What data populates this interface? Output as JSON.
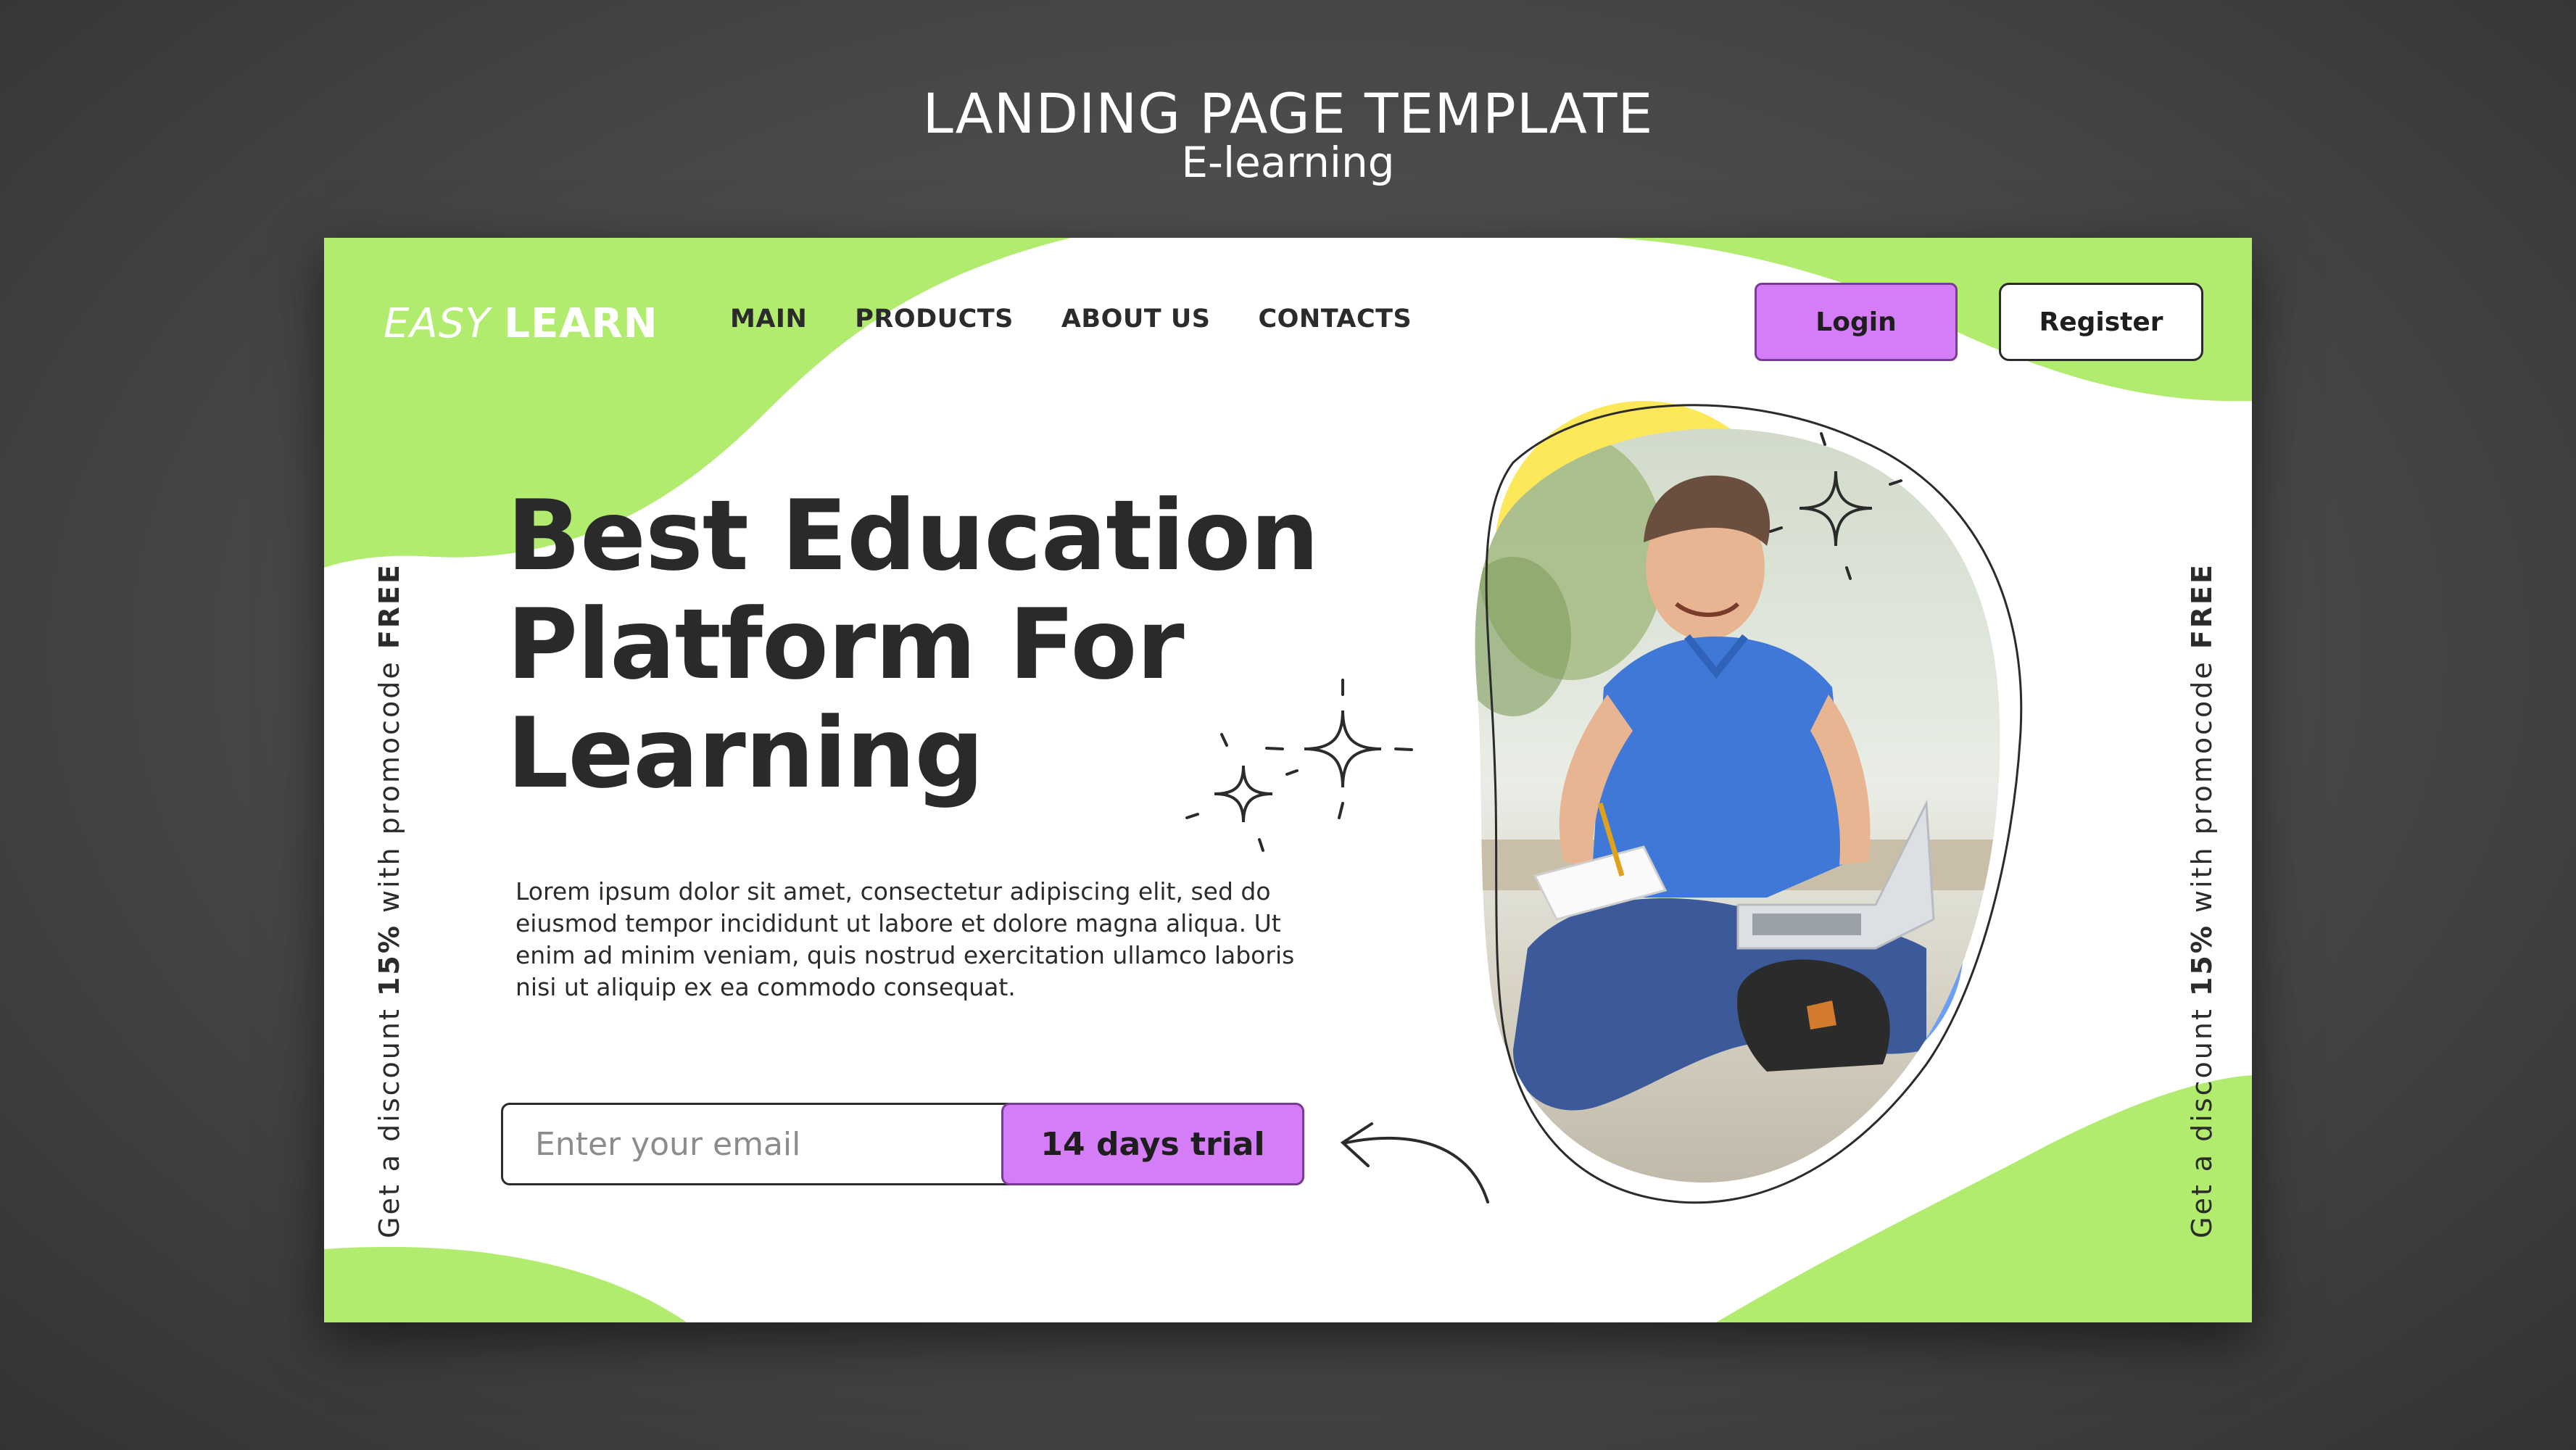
{
  "showcase": {
    "title": "LANDING PAGE TEMPLATE",
    "subtitle": "E-learning"
  },
  "brand": {
    "logo_part1": "EASY",
    "logo_part2": "LEARN"
  },
  "nav": {
    "items": [
      {
        "label": "MAIN"
      },
      {
        "label": "PRODUCTS"
      },
      {
        "label": "ABOUT US"
      },
      {
        "label": "CONTACTS"
      }
    ]
  },
  "auth": {
    "login_label": "Login",
    "register_label": "Register"
  },
  "hero": {
    "title_lines": [
      "Best Education",
      "Platform For",
      "Learning"
    ],
    "body": "Lorem ipsum dolor sit amet, consectetur adipiscing elit, sed do eiusmod tempor incididunt ut labore et dolore magna aliqua. Ut enim ad minim veniam, quis nostrud exercitation ullamco laboris nisi ut aliquip ex ea commodo consequat."
  },
  "signup": {
    "email_placeholder": "Enter your email",
    "trial_label": "14 days trial"
  },
  "promo": {
    "part1": "Get a discount ",
    "discount": "15%",
    "part2": " with promocode ",
    "code": "FREE"
  },
  "colors": {
    "green": "#b2ec6e",
    "purple": "#d57cf7",
    "yellow": "#fde85a",
    "blue": "#6b9ef7",
    "text": "#2a2a2a"
  },
  "icons": [
    "sparkle-icon",
    "arrow-icon"
  ]
}
